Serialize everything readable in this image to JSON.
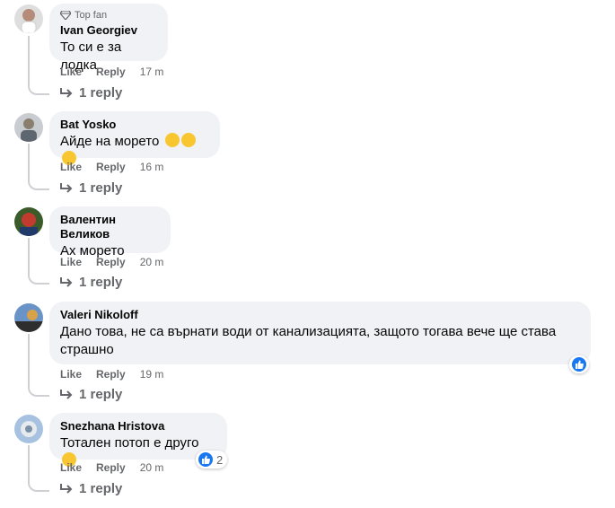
{
  "actions": {
    "like": "Like",
    "reply": "Reply"
  },
  "comments": [
    {
      "badge": "Top fan",
      "author": "Ivan Georgiev",
      "text": "То си е за лодка",
      "time": "17 m",
      "replies": "1 reply",
      "avatar_colors": [
        "#d9d9d9",
        "#b58c7a",
        "#e8e8e8"
      ]
    },
    {
      "author": "Bat Yosko",
      "text": "Айде на морето",
      "emojis": [
        "rolling-on-floor-laughing-icon",
        "rolling-on-floor-laughing-icon",
        "rolling-on-floor-laughing-icon"
      ],
      "time": "16 m",
      "replies": "1 reply",
      "avatar_colors": [
        "#9aa0a6",
        "#6e6a5e",
        "#d0c8b8"
      ]
    },
    {
      "author": "Валентин Великов",
      "text": "Ах морето",
      "time": "20 m",
      "replies": "1 reply",
      "avatar_colors": [
        "#3b5b2b",
        "#c23b2f",
        "#1f3a6b"
      ]
    },
    {
      "author": "Valeri Nikoloff",
      "text": "Дано това, не са върнати води от канализацията, защото тогава вече ще става страшно",
      "time": "19 m",
      "replies": "1 reply",
      "reaction": {
        "icon": "like-icon",
        "count": ""
      },
      "avatar_colors": [
        "#6a94c8",
        "#d8a24a",
        "#2e2e2e"
      ]
    },
    {
      "author": "Snezhana Hristova",
      "text": "Тотален потоп е друго",
      "emojis": [
        "disappointed-face-icon"
      ],
      "time": "20 m",
      "replies": "1 reply",
      "reaction": {
        "icon": "like-icon",
        "count": "2"
      },
      "avatar_colors": [
        "#a7c2e0",
        "#e6e9ee",
        "#7a8fa8"
      ]
    }
  ],
  "colors": {
    "bubble": "#f0f2f5",
    "meta": "#65676b",
    "like_blue": "#1877f2"
  }
}
